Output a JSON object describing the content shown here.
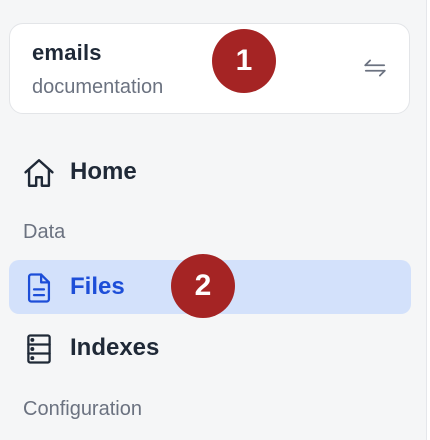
{
  "workspace": {
    "name": "emails",
    "subtitle": "documentation",
    "switch_icon": "swap-arrows-icon"
  },
  "nav": {
    "home": {
      "label": "Home",
      "icon": "home-icon"
    },
    "sections": {
      "data": "Data",
      "configuration": "Configuration"
    },
    "files": {
      "label": "Files",
      "icon": "file-text-icon",
      "active": true
    },
    "indexes": {
      "label": "Indexes",
      "icon": "server-stack-icon"
    }
  },
  "annotations": {
    "badge_1": "1",
    "badge_2": "2"
  },
  "colors": {
    "sidebar_bg": "#f5f6f7",
    "active_bg": "#d3e1fb",
    "active_text": "#1d4ed8",
    "badge": "#a52424"
  }
}
